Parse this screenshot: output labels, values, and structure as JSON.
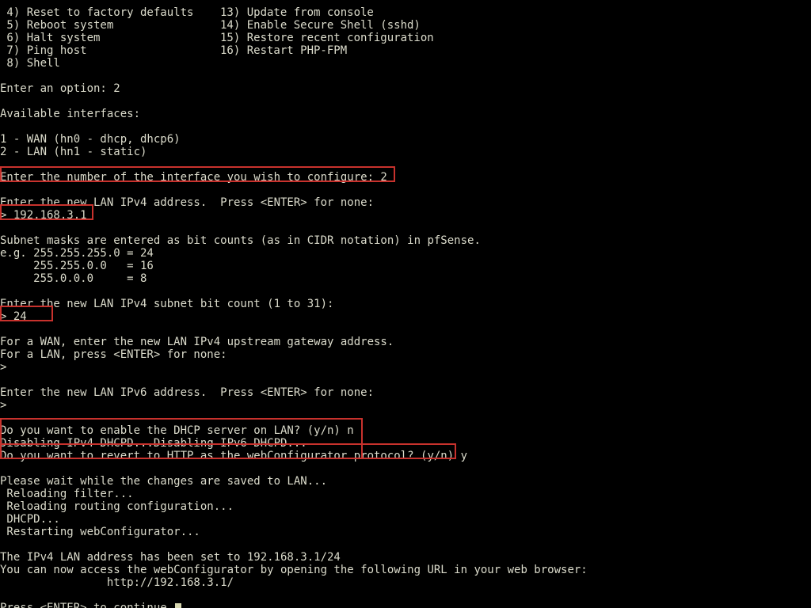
{
  "menu": {
    "left": [
      " 4) Reset to factory defaults",
      " 5) Reboot system",
      " 6) Halt system",
      " 7) Ping host",
      " 8) Shell"
    ],
    "right": [
      "13) Update from console",
      "14) Enable Secure Shell (sshd)",
      "15) Restore recent configuration",
      "16) Restart PHP-FPM"
    ]
  },
  "body": {
    "enter_option": "Enter an option: 2",
    "avail_hdr": "Available interfaces:",
    "if1": "1 - WAN (hn0 - dhcp, dhcp6)",
    "if2": "2 - LAN (hn1 - static)",
    "prompt_iface": "Enter the number of the interface you wish to configure: 2",
    "prompt_ip_hdr": "Enter the new LAN IPv4 address.  Press <ENTER> for none:",
    "prompt_ip": "> 192.168.3.1",
    "mask1": "Subnet masks are entered as bit counts (as in CIDR notation) in pfSense.",
    "mask2": "e.g. 255.255.255.0 = 24",
    "mask3": "     255.255.0.0   = 16",
    "mask4": "     255.0.0.0     = 8",
    "prompt_bits_hdr": "Enter the new LAN IPv4 subnet bit count (1 to 31):",
    "prompt_bits": "> 24",
    "gw1": "For a WAN, enter the new LAN IPv4 upstream gateway address.",
    "gw2": "For a LAN, press <ENTER> for none:",
    "gw3": "> ",
    "ipv6_1": "Enter the new LAN IPv6 address.  Press <ENTER> for none:",
    "ipv6_2": "> ",
    "dhcp_q": "Do you want to enable the DHCP server on LAN? (y/n) n",
    "dhcp_dis": "Disabling IPv4 DHCPD...Disabling IPv6 DHCPD...",
    "http_q": "Do you want to revert to HTTP as the webConfigurator protocol? (y/n) y",
    "wait": "Please wait while the changes are saved to LAN...",
    "rel1": " Reloading filter...",
    "rel2": " Reloading routing configuration...",
    "rel3": " DHCPD...",
    "rel4": " Restarting webConfigurator...",
    "done1": "The IPv4 LAN address has been set to 192.168.3.1/24",
    "done2": "You can now access the webConfigurator by opening the following URL in your web browser:",
    "done3": "                http://192.168.3.1/",
    "press_enter": "Press <ENTER> to continue."
  }
}
